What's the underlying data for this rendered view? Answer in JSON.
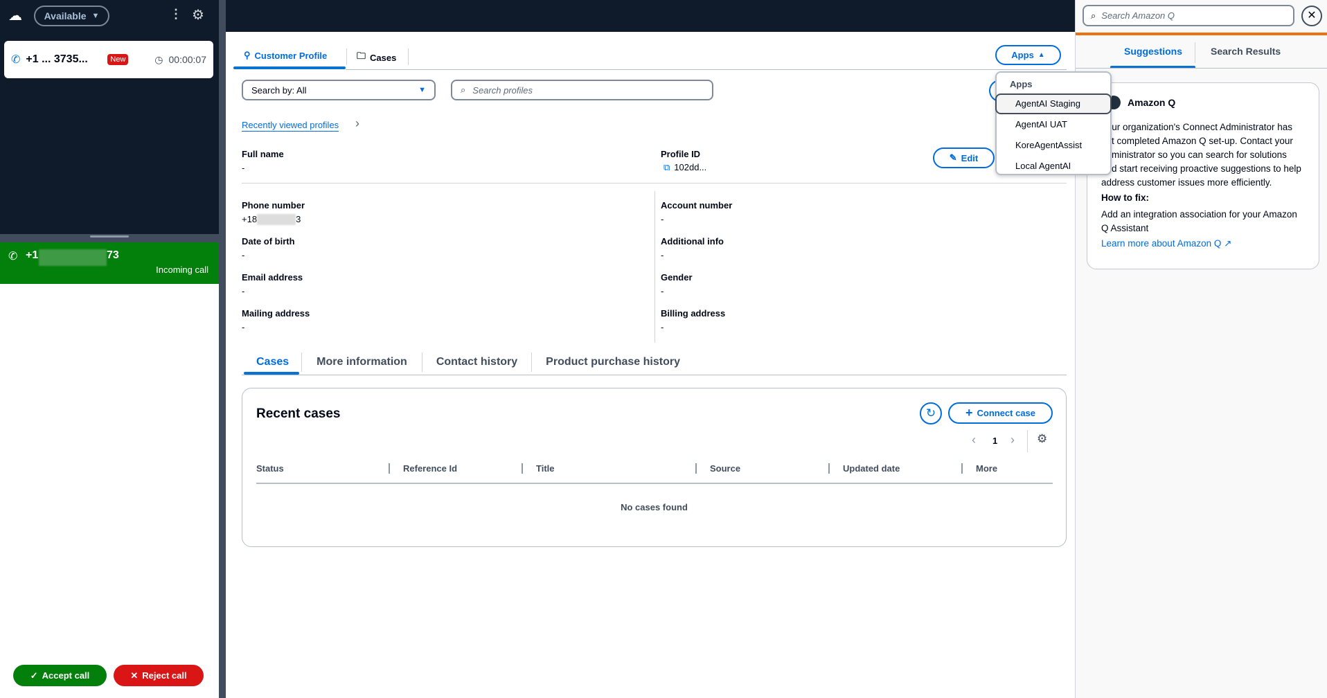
{
  "ccp": {
    "status": "Available",
    "contact_number_visible": "+1 ... 3735...",
    "contact_badge": "New",
    "contact_timer": "00:00:07",
    "incoming_number_prefix": "+1",
    "incoming_number_suffix": "73",
    "incoming_label": "Incoming call",
    "accept_label": "Accept call",
    "reject_label": "Reject call"
  },
  "main": {
    "tabs": [
      "Customer Profile",
      "Cases"
    ],
    "apps_label": "Apps",
    "search_by": "Search by: All",
    "search_placeholder": "Search profiles",
    "recently_viewed": "Recently viewed profiles",
    "edit_label": "Edit",
    "profile": {
      "full_name_label": "Full name",
      "full_name": "-",
      "profile_id_label": "Profile ID",
      "profile_id": "102dd...",
      "left_fields": [
        {
          "label": "Phone number",
          "value": "+18"
        },
        {
          "label": "Date of birth",
          "value": "-"
        },
        {
          "label": "Email address",
          "value": "-"
        },
        {
          "label": "Mailing address",
          "value": "-"
        }
      ],
      "phone_suffix": "3",
      "right_fields": [
        {
          "label": "Account number",
          "value": "-"
        },
        {
          "label": "Additional info",
          "value": "-"
        },
        {
          "label": "Gender",
          "value": "-"
        },
        {
          "label": "Billing address",
          "value": "-"
        }
      ]
    },
    "subtabs": [
      "Cases",
      "More information",
      "Contact history",
      "Product purchase history"
    ],
    "cases": {
      "title": "Recent cases",
      "connect_label": "Connect case",
      "page": "1",
      "columns": [
        "Status",
        "Reference Id",
        "Title",
        "Source",
        "Updated date",
        "More"
      ],
      "empty": "No cases found"
    }
  },
  "apps_menu": {
    "header": "Apps",
    "items": [
      "AgentAI Staging",
      "AgentAI UAT",
      "KoreAgentAssist",
      "Local AgentAI"
    ]
  },
  "amazon_q": {
    "search_placeholder": "Search Amazon Q",
    "tabs": [
      "Suggestions",
      "Search Results"
    ],
    "title": "Amazon Q",
    "body": "Your organization's Connect Administrator has not completed Amazon Q set-up. Contact your administrator so you can search for solutions and start receiving proactive suggestions to help address customer issues more efficiently.",
    "howto_label": "How to fix:",
    "howto_text": "Add an integration association for your Amazon Q Assistant",
    "learn_more": "Learn more about Amazon Q"
  },
  "colors": {
    "accent": "#0972d3",
    "teal": "#006ce0",
    "green": "#037f0c",
    "red": "#d91515",
    "dark": "#0f1b2a",
    "orange": "#ec7211"
  }
}
